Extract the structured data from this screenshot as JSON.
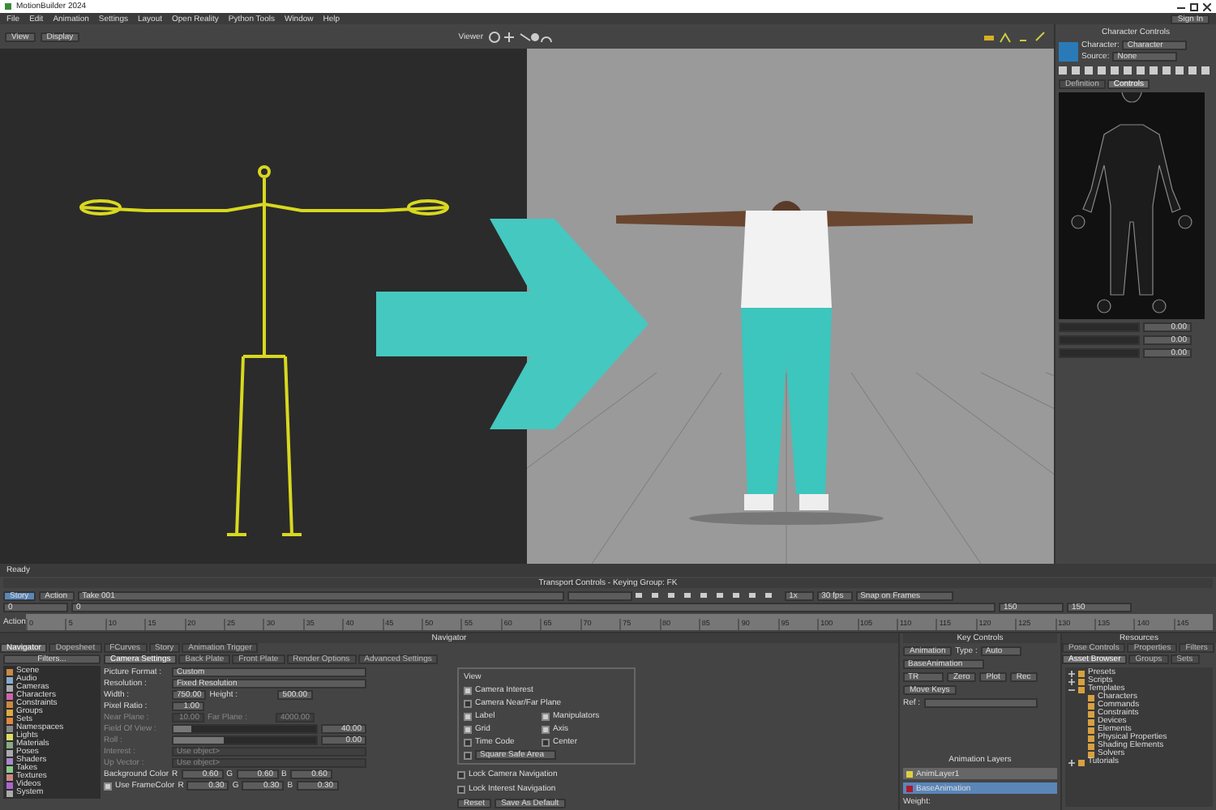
{
  "window": {
    "title": "MotionBuilder 2024",
    "account": "Sign In"
  },
  "menu": [
    "File",
    "Edit",
    "Animation",
    "Settings",
    "Layout",
    "Open Reality",
    "Python Tools",
    "Window",
    "Help"
  ],
  "viewer": {
    "buttons": [
      "View",
      "Display"
    ],
    "label": "Viewer"
  },
  "character_controls": {
    "title": "Character Controls",
    "character_label": "Character:",
    "character": "Character",
    "source_label": "Source:",
    "source": "None",
    "tabs": [
      {
        "label": "Definition",
        "selected": false
      },
      {
        "label": "Controls",
        "selected": true
      }
    ],
    "readings": [
      "0.00",
      "0.00",
      "0.00"
    ]
  },
  "status": "Ready",
  "transport": {
    "title": "Transport Controls - Keying Group: FK",
    "modes": [
      {
        "label": "Story",
        "selected": true
      },
      {
        "label": "Action",
        "selected": false
      }
    ],
    "take": "Take 001",
    "speed": "1x",
    "fps": "30 fps",
    "snap": "Snap on Frames",
    "start": "0",
    "current": "0",
    "end": "150",
    "end_field": "150",
    "ticks": [
      "0",
      "5",
      "10",
      "15",
      "20",
      "25",
      "30",
      "35",
      "40",
      "45",
      "50",
      "55",
      "60",
      "65",
      "70",
      "75",
      "80",
      "85",
      "90",
      "95",
      "100",
      "105",
      "110",
      "115",
      "120",
      "125",
      "130",
      "135",
      "140",
      "145"
    ],
    "track_label": "Action"
  },
  "navigator": {
    "title": "Navigator",
    "tabs": [
      {
        "label": "Navigator",
        "selected": true
      },
      {
        "label": "Dopesheet",
        "selected": false
      },
      {
        "label": "FCurves",
        "selected": false
      },
      {
        "label": "Story",
        "selected": false
      },
      {
        "label": "Animation Trigger",
        "selected": false
      }
    ],
    "filters": "Filters...",
    "tree": [
      "Scene",
      "Audio",
      "Cameras",
      "Characters",
      "Constraints",
      "Groups",
      "Sets",
      "Namespaces",
      "Lights",
      "Materials",
      "Poses",
      "Shaders",
      "Takes",
      "Textures",
      "Videos",
      "System"
    ],
    "settings_tabs": [
      {
        "label": "Camera Settings",
        "selected": true
      },
      {
        "label": "Back Plate",
        "selected": false
      },
      {
        "label": "Front Plate",
        "selected": false
      },
      {
        "label": "Render Options",
        "selected": false
      },
      {
        "label": "Advanced Settings",
        "selected": false
      }
    ],
    "picture_format": {
      "label": "Picture Format :",
      "value": "Custom"
    },
    "resolution": {
      "label": "Resolution :",
      "value": "Fixed Resolution"
    },
    "width": {
      "label": "Width :",
      "value": "750.00"
    },
    "height": {
      "label": "Height :",
      "value": "500.00"
    },
    "pixel_ratio": {
      "label": "Pixel Ratio :",
      "value": "1.00"
    },
    "near": {
      "label": "Near Plane :",
      "value": "10.00"
    },
    "far": {
      "label": "Far Plane :",
      "value": "4000.00"
    },
    "fov": {
      "label": "Field Of View :",
      "value": "40.00",
      "level": 0.12
    },
    "roll": {
      "label": "Roll :",
      "value": "0.00",
      "level": 0.35
    },
    "interest": {
      "label": "Interest :",
      "value": "Use object>"
    },
    "up_vector": {
      "label": "Up Vector :",
      "value": "Use object>"
    },
    "background": {
      "label": "Background Color",
      "channels": [
        "R",
        "G",
        "B"
      ],
      "values": [
        "0.60",
        "0.60",
        "0.60"
      ]
    },
    "frame_color": {
      "label": "Use FrameColor",
      "checked": true,
      "channels": [
        "R",
        "G",
        "B"
      ],
      "values": [
        "0.30",
        "0.30",
        "0.30"
      ]
    },
    "view_title": "View",
    "view_options": [
      [
        {
          "label": "Camera Interest",
          "checked": true
        }
      ],
      [
        {
          "label": "Camera Near/Far Plane",
          "checked": false
        }
      ],
      [
        {
          "label": "Label",
          "checked": true
        },
        {
          "label": "Manipulators",
          "checked": true
        }
      ],
      [
        {
          "label": "Grid",
          "checked": true
        },
        {
          "label": "Axis",
          "checked": true
        }
      ],
      [
        {
          "label": "Time Code",
          "checked": false
        },
        {
          "label": "Center",
          "checked": false
        }
      ]
    ],
    "safe_area": {
      "checked": false,
      "value": "Square Safe Area"
    },
    "locks": [
      {
        "label": "Lock Camera Navigation",
        "checked": false
      },
      {
        "label": "Lock Interest Navigation",
        "checked": false
      }
    ],
    "buttons": [
      "Reset",
      "Save As Default"
    ]
  },
  "key_controls": {
    "title": "Key Controls",
    "animation": "Animation",
    "type_label": "Type :",
    "type": "Auto",
    "layer": "BaseAnimation",
    "channels": "TR",
    "buttons": [
      "Zero",
      "Plot",
      "Rec"
    ],
    "move_keys": "Move Keys",
    "ref": "Ref :",
    "layers_title": "Animation Layers",
    "layers": [
      {
        "name": "AnimLayer1",
        "color": "#e0d040",
        "selected": false
      },
      {
        "name": "BaseAnimation",
        "color": "#b01830",
        "selected": true
      }
    ],
    "weight": "Weight:"
  },
  "resources": {
    "title": "Resources",
    "tabs": [
      {
        "label": "Pose Controls",
        "selected": false
      },
      {
        "label": "Properties",
        "selected": false
      },
      {
        "label": "Filters",
        "selected": false
      },
      {
        "label": "Asset Browser",
        "selected": true
      },
      {
        "label": "Groups",
        "selected": false
      },
      {
        "label": "Sets",
        "selected": false
      }
    ],
    "tree": [
      {
        "name": "Presets",
        "expanded": false
      },
      {
        "name": "Scripts",
        "expanded": false
      },
      {
        "name": "Templates",
        "expanded": true,
        "children": [
          {
            "name": "Characters"
          },
          {
            "name": "Commands"
          },
          {
            "name": "Constraints"
          },
          {
            "name": "Devices"
          },
          {
            "name": "Elements"
          },
          {
            "name": "Physical Properties"
          },
          {
            "name": "Shading Elements"
          },
          {
            "name": "Solvers"
          }
        ]
      },
      {
        "name": "Tutorials",
        "expanded": false
      }
    ]
  }
}
